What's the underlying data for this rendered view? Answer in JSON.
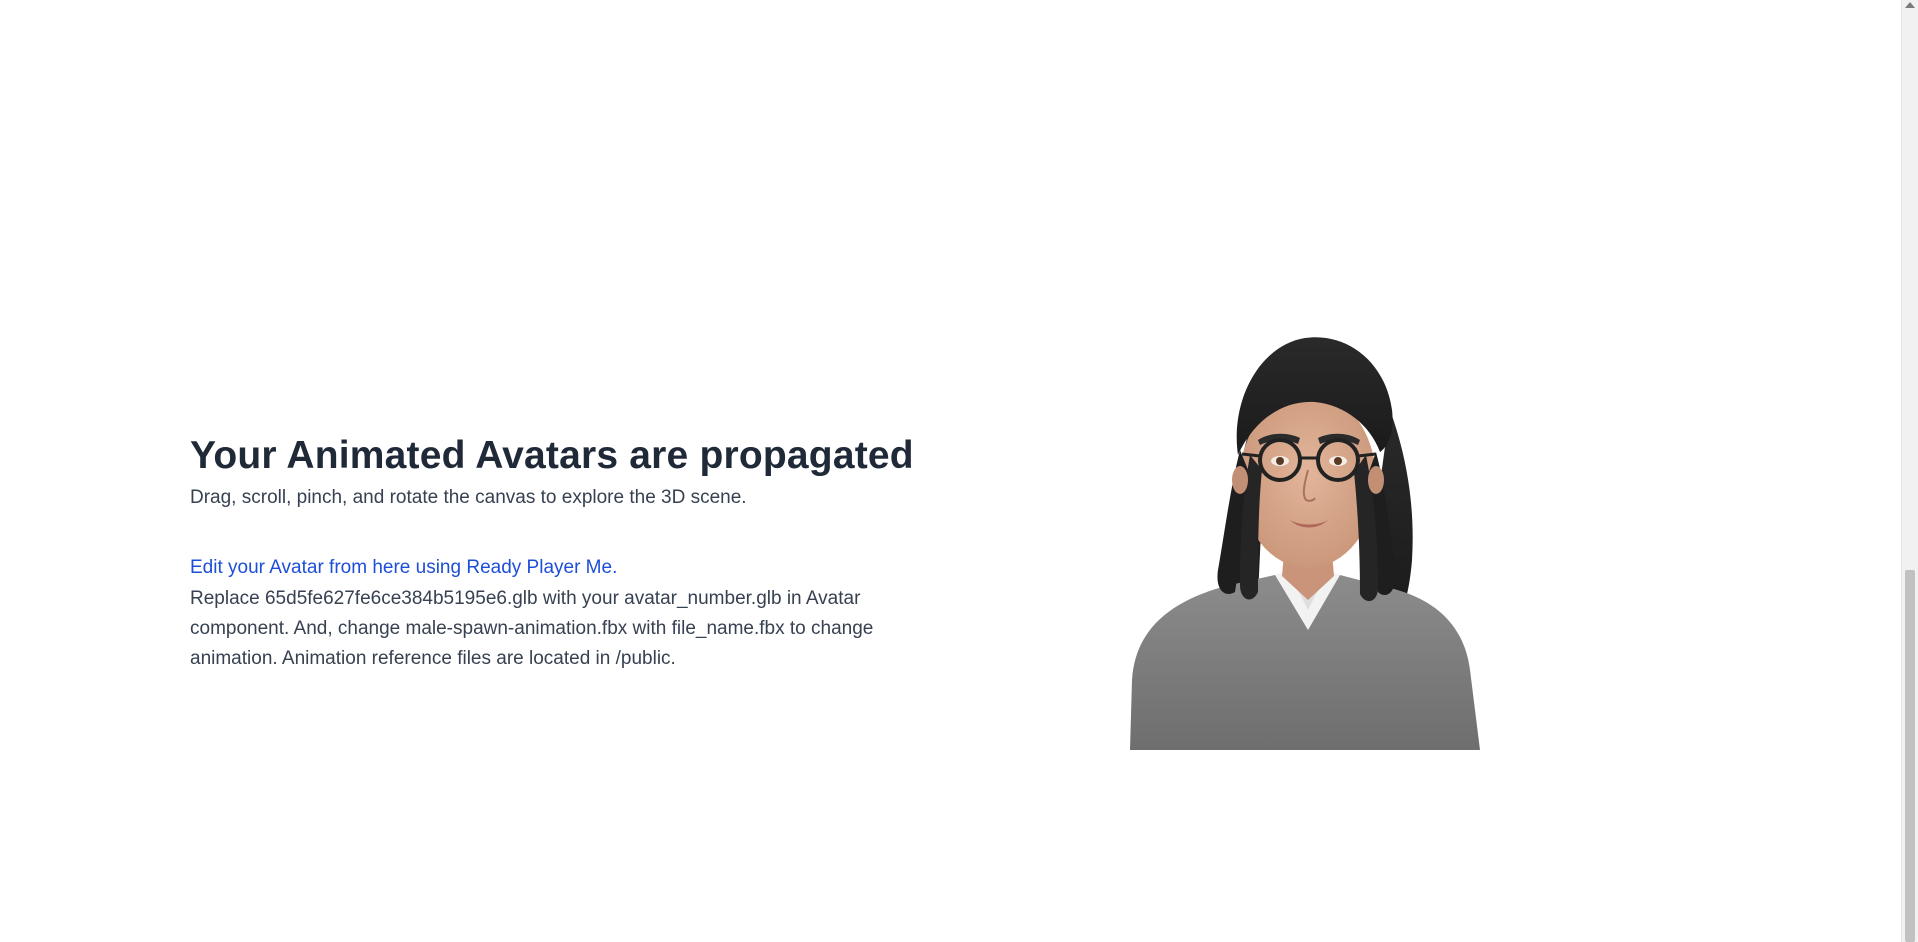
{
  "hero": {
    "title": "Your Animated Avatars are propagated",
    "subtitle": "Drag, scroll, pinch, and rotate the canvas to explore the 3D scene.",
    "edit_link": "Edit your Avatar from here using Ready Player Me.",
    "instructions": "Replace 65d5fe627fe6ce384b5195e6.glb with your avatar_number.glb in Avatar component. And, change male-spawn-animation.fbx with file_name.fbx to change animation. Animation reference files are located in /public."
  },
  "colors": {
    "heading": "#1f2937",
    "body_text": "#374151",
    "link": "#1d4ed8",
    "background": "#ffffff"
  }
}
